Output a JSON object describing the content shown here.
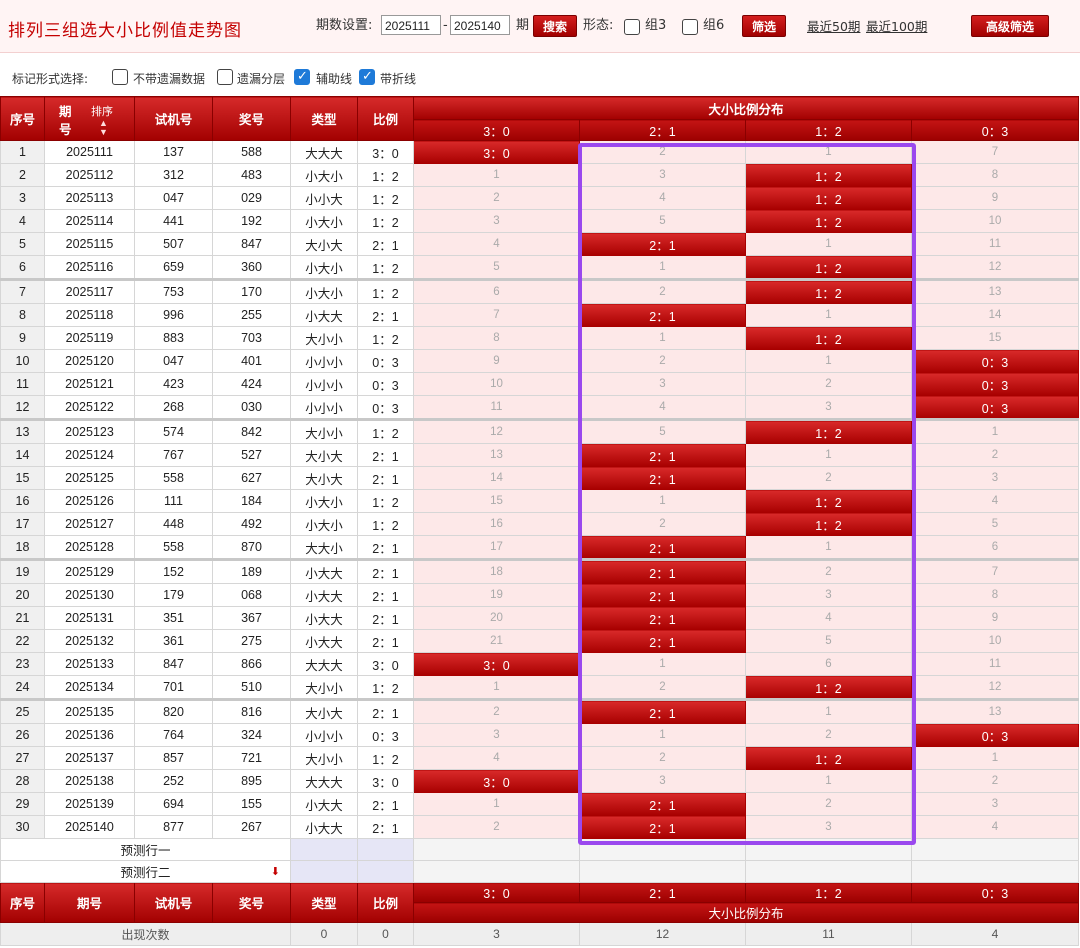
{
  "header": {
    "title": "排列三组选大小比例值走势图",
    "period_label": "期数设置:",
    "period_start": "2025111",
    "period_sep": "-",
    "period_end": "2025140",
    "period_suffix": "期",
    "search_label": "搜索",
    "form_label": "形态:",
    "group3_label": "组3",
    "group6_label": "组6",
    "filter_label": "筛选",
    "recent50_label": "最近50期",
    "recent100_label": "最近100期",
    "advanced_label": "高级筛选"
  },
  "mark_bar": {
    "label": "标记形式选择:",
    "options": [
      {
        "label": "不带遗漏数据",
        "checked": false
      },
      {
        "label": "遗漏分层",
        "checked": false
      },
      {
        "label": "辅助线",
        "checked": true
      },
      {
        "label": "带折线",
        "checked": true
      }
    ]
  },
  "table": {
    "columns": {
      "seq": "序号",
      "period_a": "期",
      "period_b": "号",
      "sort": "排序",
      "trial": "试机号",
      "prize": "奖号",
      "type": "类型",
      "ratio": "比例",
      "dist": "大小比例分布"
    },
    "ratio_headers": [
      "3：0",
      "2：1",
      "1：2",
      "0：3"
    ],
    "rows": [
      {
        "seq": "1",
        "period": "2025111",
        "trial": "137",
        "prize": "588",
        "type": "大大大",
        "ratio": "3：0",
        "dist": [
          "3：0",
          "2",
          "1",
          "7"
        ],
        "hit": 0
      },
      {
        "seq": "2",
        "period": "2025112",
        "trial": "312",
        "prize": "483",
        "type": "小大小",
        "ratio": "1：2",
        "dist": [
          "1",
          "3",
          "1：2",
          "8"
        ],
        "hit": 2
      },
      {
        "seq": "3",
        "period": "2025113",
        "trial": "047",
        "prize": "029",
        "type": "小小大",
        "ratio": "1：2",
        "dist": [
          "2",
          "4",
          "1：2",
          "9"
        ],
        "hit": 2
      },
      {
        "seq": "4",
        "period": "2025114",
        "trial": "441",
        "prize": "192",
        "type": "小大小",
        "ratio": "1：2",
        "dist": [
          "3",
          "5",
          "1：2",
          "10"
        ],
        "hit": 2
      },
      {
        "seq": "5",
        "period": "2025115",
        "trial": "507",
        "prize": "847",
        "type": "大小大",
        "ratio": "2：1",
        "dist": [
          "4",
          "2：1",
          "1",
          "11"
        ],
        "hit": 1
      },
      {
        "seq": "6",
        "period": "2025116",
        "trial": "659",
        "prize": "360",
        "type": "小大小",
        "ratio": "1：2",
        "dist": [
          "5",
          "1",
          "1：2",
          "12"
        ],
        "hit": 2
      },
      {
        "seq": "7",
        "period": "2025117",
        "trial": "753",
        "prize": "170",
        "type": "小大小",
        "ratio": "1：2",
        "dist": [
          "6",
          "2",
          "1：2",
          "13"
        ],
        "hit": 2
      },
      {
        "seq": "8",
        "period": "2025118",
        "trial": "996",
        "prize": "255",
        "type": "小大大",
        "ratio": "2：1",
        "dist": [
          "7",
          "2：1",
          "1",
          "14"
        ],
        "hit": 1
      },
      {
        "seq": "9",
        "period": "2025119",
        "trial": "883",
        "prize": "703",
        "type": "大小小",
        "ratio": "1：2",
        "dist": [
          "8",
          "1",
          "1：2",
          "15"
        ],
        "hit": 2
      },
      {
        "seq": "10",
        "period": "2025120",
        "trial": "047",
        "prize": "401",
        "type": "小小小",
        "ratio": "0：3",
        "dist": [
          "9",
          "2",
          "1",
          "0：3"
        ],
        "hit": 3
      },
      {
        "seq": "11",
        "period": "2025121",
        "trial": "423",
        "prize": "424",
        "type": "小小小",
        "ratio": "0：3",
        "dist": [
          "10",
          "3",
          "2",
          "0：3"
        ],
        "hit": 3
      },
      {
        "seq": "12",
        "period": "2025122",
        "trial": "268",
        "prize": "030",
        "type": "小小小",
        "ratio": "0：3",
        "dist": [
          "11",
          "4",
          "3",
          "0：3"
        ],
        "hit": 3
      },
      {
        "seq": "13",
        "period": "2025123",
        "trial": "574",
        "prize": "842",
        "type": "大小小",
        "ratio": "1：2",
        "dist": [
          "12",
          "5",
          "1：2",
          "1"
        ],
        "hit": 2
      },
      {
        "seq": "14",
        "period": "2025124",
        "trial": "767",
        "prize": "527",
        "type": "大小大",
        "ratio": "2：1",
        "dist": [
          "13",
          "2：1",
          "1",
          "2"
        ],
        "hit": 1
      },
      {
        "seq": "15",
        "period": "2025125",
        "trial": "558",
        "prize": "627",
        "type": "大小大",
        "ratio": "2：1",
        "dist": [
          "14",
          "2：1",
          "2",
          "3"
        ],
        "hit": 1
      },
      {
        "seq": "16",
        "period": "2025126",
        "trial": "111",
        "prize": "184",
        "type": "小大小",
        "ratio": "1：2",
        "dist": [
          "15",
          "1",
          "1：2",
          "4"
        ],
        "hit": 2
      },
      {
        "seq": "17",
        "period": "2025127",
        "trial": "448",
        "prize": "492",
        "type": "小大小",
        "ratio": "1：2",
        "dist": [
          "16",
          "2",
          "1：2",
          "5"
        ],
        "hit": 2
      },
      {
        "seq": "18",
        "period": "2025128",
        "trial": "558",
        "prize": "870",
        "type": "大大小",
        "ratio": "2：1",
        "dist": [
          "17",
          "2：1",
          "1",
          "6"
        ],
        "hit": 1
      },
      {
        "seq": "19",
        "period": "2025129",
        "trial": "152",
        "prize": "189",
        "type": "小大大",
        "ratio": "2：1",
        "dist": [
          "18",
          "2：1",
          "2",
          "7"
        ],
        "hit": 1
      },
      {
        "seq": "20",
        "period": "2025130",
        "trial": "179",
        "prize": "068",
        "type": "小大大",
        "ratio": "2：1",
        "dist": [
          "19",
          "2：1",
          "3",
          "8"
        ],
        "hit": 1
      },
      {
        "seq": "21",
        "period": "2025131",
        "trial": "351",
        "prize": "367",
        "type": "小大大",
        "ratio": "2：1",
        "dist": [
          "20",
          "2：1",
          "4",
          "9"
        ],
        "hit": 1
      },
      {
        "seq": "22",
        "period": "2025132",
        "trial": "361",
        "prize": "275",
        "type": "小大大",
        "ratio": "2：1",
        "dist": [
          "21",
          "2：1",
          "5",
          "10"
        ],
        "hit": 1
      },
      {
        "seq": "23",
        "period": "2025133",
        "trial": "847",
        "prize": "866",
        "type": "大大大",
        "ratio": "3：0",
        "dist": [
          "3：0",
          "1",
          "6",
          "11"
        ],
        "hit": 0
      },
      {
        "seq": "24",
        "period": "2025134",
        "trial": "701",
        "prize": "510",
        "type": "大小小",
        "ratio": "1：2",
        "dist": [
          "1",
          "2",
          "1：2",
          "12"
        ],
        "hit": 2
      },
      {
        "seq": "25",
        "period": "2025135",
        "trial": "820",
        "prize": "816",
        "type": "大小大",
        "ratio": "2：1",
        "dist": [
          "2",
          "2：1",
          "1",
          "13"
        ],
        "hit": 1
      },
      {
        "seq": "26",
        "period": "2025136",
        "trial": "764",
        "prize": "324",
        "type": "小小小",
        "ratio": "0：3",
        "dist": [
          "3",
          "1",
          "2",
          "0：3"
        ],
        "hit": 3
      },
      {
        "seq": "27",
        "period": "2025137",
        "trial": "857",
        "prize": "721",
        "type": "大小小",
        "ratio": "1：2",
        "dist": [
          "4",
          "2",
          "1：2",
          "1"
        ],
        "hit": 2
      },
      {
        "seq": "28",
        "period": "2025138",
        "trial": "252",
        "prize": "895",
        "type": "大大大",
        "ratio": "3：0",
        "dist": [
          "3：0",
          "3",
          "1",
          "2"
        ],
        "hit": 0
      },
      {
        "seq": "29",
        "period": "2025139",
        "trial": "694",
        "prize": "155",
        "type": "小大大",
        "ratio": "2：1",
        "dist": [
          "1",
          "2：1",
          "2",
          "3"
        ],
        "hit": 1
      },
      {
        "seq": "30",
        "period": "2025140",
        "trial": "877",
        "prize": "267",
        "type": "小大大",
        "ratio": "2：1",
        "dist": [
          "2",
          "2：1",
          "3",
          "4"
        ],
        "hit": 1
      }
    ],
    "predict_rows": [
      "预测行一",
      "预测行二"
    ],
    "footer": {
      "count_label": "出现次数",
      "counts": [
        "0",
        "0",
        "3",
        "12",
        "11",
        "4"
      ]
    }
  },
  "colors": {
    "accent": "#c40000",
    "highlight_frame": "#9a48ee",
    "miss_bg": "#fde8e8"
  }
}
